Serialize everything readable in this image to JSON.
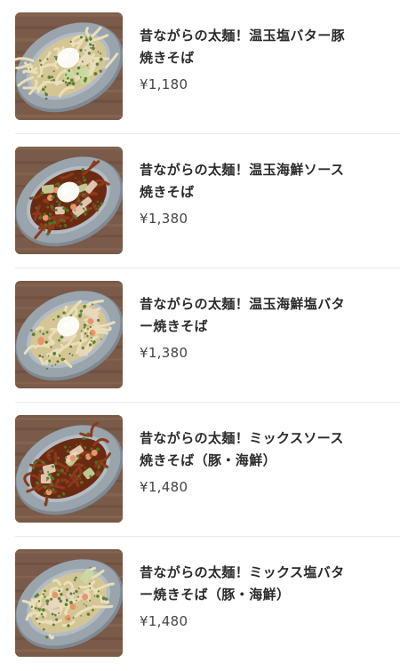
{
  "menu": {
    "items": [
      {
        "name": "昔ながらの太麺！温玉塩バター豚焼きそば",
        "price": "¥1,180",
        "image": "shio-butter-pork-yakisoba-photo",
        "sauce": "salt",
        "egg": true,
        "shrimp": false
      },
      {
        "name": "昔ながらの太麺！温玉海鮮ソース焼きそば",
        "price": "¥1,380",
        "image": "seafood-sauce-yakisoba-photo",
        "sauce": "sauce",
        "egg": true,
        "shrimp": true
      },
      {
        "name": "昔ながらの太麺！温玉海鮮塩バター焼きそば",
        "price": "¥1,380",
        "image": "seafood-shio-butter-yakisoba-photo",
        "sauce": "salt",
        "egg": true,
        "shrimp": true
      },
      {
        "name": "昔ながらの太麺！ミックスソース焼きそば（豚・海鮮）",
        "price": "¥1,480",
        "image": "mix-sauce-yakisoba-photo",
        "sauce": "sauce",
        "egg": false,
        "shrimp": true
      },
      {
        "name": "昔ながらの太麺！ミックス塩バター焼きそば（豚・海鮮）",
        "price": "¥1,480",
        "image": "mix-shio-butter-yakisoba-photo",
        "sauce": "salt",
        "egg": false,
        "shrimp": true
      }
    ]
  },
  "colors": {
    "divider": "#e9e9ec",
    "text": "#2b2b2b",
    "price": "#444444",
    "table_wood": "#7a5a48",
    "plate": "#9aa4ad",
    "noodle_salt": "#eadfb8",
    "noodle_sauce": "#8c3a1c",
    "aonori": "#4f7a2a",
    "egg": "#fbfbf6"
  }
}
